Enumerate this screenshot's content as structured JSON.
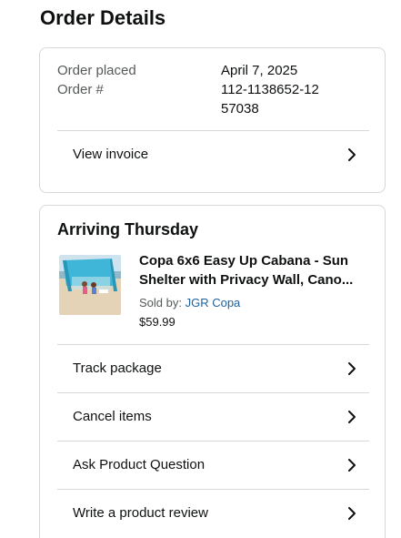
{
  "page": {
    "title": "Order Details"
  },
  "summary": {
    "order_placed_label": "Order placed",
    "order_placed_value": "April 7, 2025",
    "order_number_label": "Order #",
    "order_number_value": "112-1138652-1257038",
    "view_invoice_label": "View invoice"
  },
  "shipment": {
    "status": "Arriving Thursday",
    "product": {
      "title": "Copa 6x6 Easy Up Cabana - Sun Shelter with Privacy Wall, Cano...",
      "sold_by_label": "Sold by: ",
      "seller": "JGR Copa",
      "price": "$59.99",
      "image_icon": "product-photo-cabana"
    },
    "actions": [
      {
        "label": "Track package"
      },
      {
        "label": "Cancel items"
      },
      {
        "label": "Ask Product Question"
      },
      {
        "label": "Write a product review"
      }
    ]
  },
  "colors": {
    "text": "#0f1111",
    "secondary_text": "#565959",
    "link": "#2162a1",
    "border": "#d5d9d9"
  }
}
